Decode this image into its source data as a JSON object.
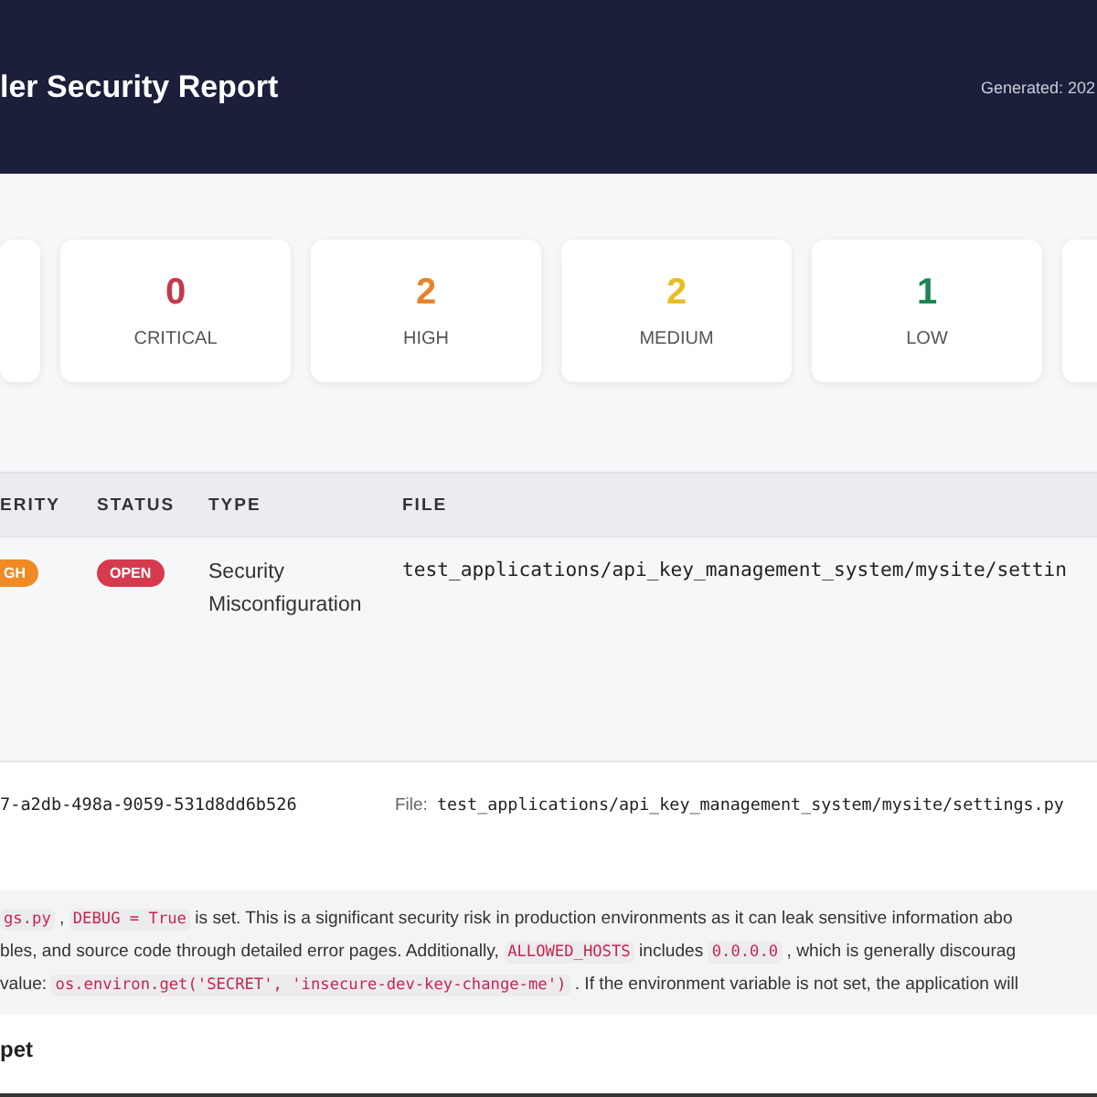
{
  "header": {
    "title": "ler Security Report",
    "generated": "Generated: 202"
  },
  "summary": [
    {
      "kind": "partial"
    },
    {
      "kind": "count",
      "value": "0",
      "label": "CRITICAL",
      "color": "#c8374a"
    },
    {
      "kind": "count",
      "value": "2",
      "label": "HIGH",
      "color": "#e8832a"
    },
    {
      "kind": "count",
      "value": "2",
      "label": "MEDIUM",
      "color": "#e9bd22"
    },
    {
      "kind": "count",
      "value": "1",
      "label": "LOW",
      "color": "#1e8455"
    },
    {
      "kind": "partial"
    }
  ],
  "table": {
    "columns": [
      "ERITY",
      "STATUS",
      "TYPE",
      "FILE"
    ],
    "rows": [
      {
        "severity": {
          "label": "GH",
          "color": "#f08a24"
        },
        "status": {
          "label": "OPEN",
          "color": "#d63a4e"
        },
        "type": "Security Misconfiguration",
        "file": "test_applications/api_key_management_system/mysite/settin"
      }
    ]
  },
  "detail": {
    "id": "7-a2db-498a-9059-531d8dd6b526",
    "file_label": "File:",
    "file": "test_applications/api_key_management_system/mysite/settings.py",
    "description": [
      [
        {
          "kind": "code",
          "text": "gs.py"
        },
        {
          "kind": "text",
          "text": " , "
        },
        {
          "kind": "code",
          "text": "DEBUG = True"
        },
        {
          "kind": "text",
          "text": " is set. This is a significant security risk in production environments as it can leak sensitive information abo"
        }
      ],
      [
        {
          "kind": "text",
          "text": "bles, and source code through detailed error pages. Additionally, "
        },
        {
          "kind": "code",
          "text": "ALLOWED_HOSTS"
        },
        {
          "kind": "text",
          "text": " includes "
        },
        {
          "kind": "code",
          "text": "0.0.0.0"
        },
        {
          "kind": "text",
          "text": " , which is generally discourag"
        }
      ],
      [
        {
          "kind": "text",
          "text": "value: "
        },
        {
          "kind": "code",
          "text": "os.environ.get('SECRET', 'insecure-dev-key-change-me')"
        },
        {
          "kind": "text",
          "text": " . If the environment variable is not set, the application will"
        }
      ]
    ],
    "section_title": "pet"
  }
}
